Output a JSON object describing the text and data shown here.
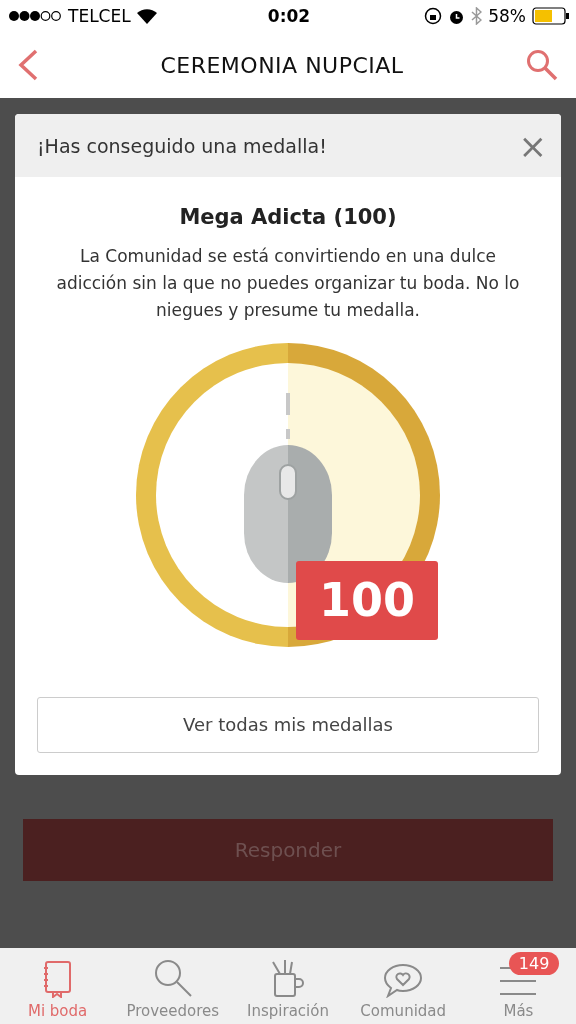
{
  "status_bar": {
    "carrier": "TELCEL",
    "time": "0:02",
    "battery": "58%"
  },
  "nav": {
    "title": "CEREMONIA NUPCIAL"
  },
  "modal": {
    "header": "¡Has conseguido una medalla!",
    "close": "×",
    "title": "Mega Adicta (100)",
    "description": "La Comunidad se está convirtiendo en una dulce adicción sin la que no puedes organizar tu boda. No lo niegues y presume tu medalla.",
    "medal_count": "100",
    "button": "Ver todas mis medallas"
  },
  "reply_button": "Responder",
  "tabs": [
    {
      "label": "Mi boda",
      "selected": true
    },
    {
      "label": "Proveedores",
      "selected": false
    },
    {
      "label": "Inspiración",
      "selected": false
    },
    {
      "label": "Comunidad",
      "selected": false
    },
    {
      "label": "Más",
      "selected": false,
      "badge": "149"
    }
  ]
}
